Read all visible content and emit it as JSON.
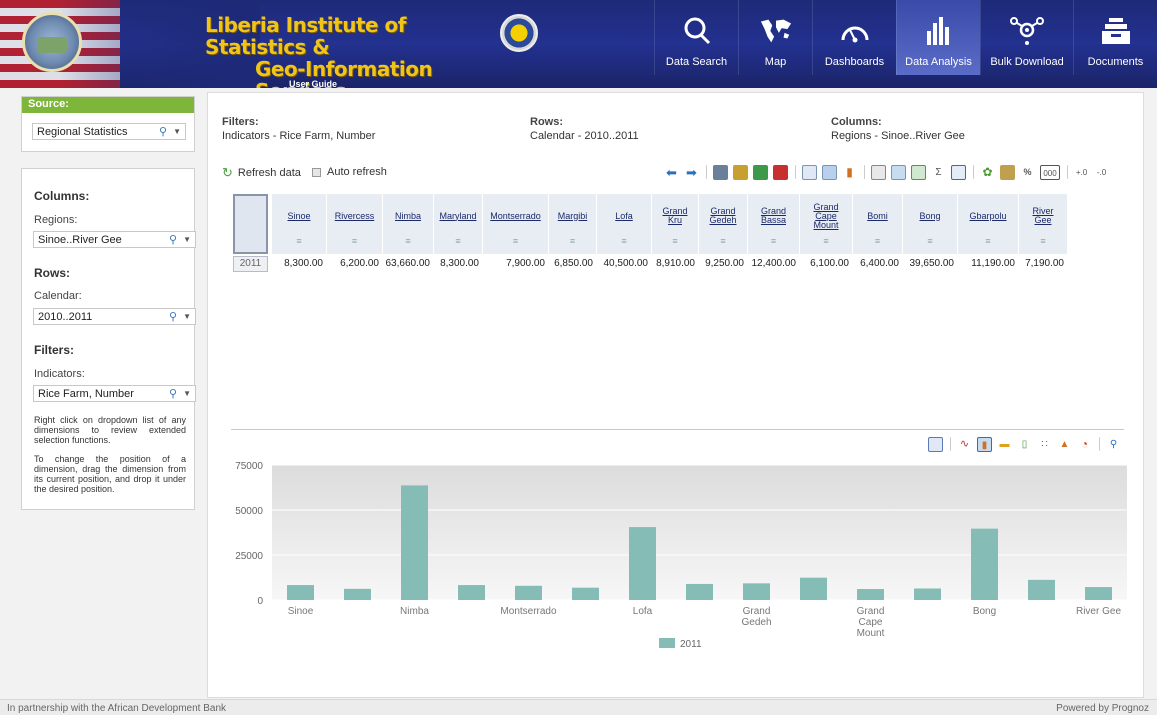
{
  "header": {
    "title_line1": "Liberia Institute of Statistics &",
    "title_line2": "Geo-Information Services",
    "user_guide": "User Guide",
    "nav": [
      {
        "label": "Data Search",
        "icon": "search-icon"
      },
      {
        "label": "Map",
        "icon": "world-map-icon"
      },
      {
        "label": "Dashboards",
        "icon": "gauge-icon"
      },
      {
        "label": "Data Analysis",
        "icon": "bar-chart-icon",
        "active": true
      },
      {
        "label": "Bulk Download",
        "icon": "network-icon"
      },
      {
        "label": "Documents",
        "icon": "document-stack-icon"
      }
    ]
  },
  "source": {
    "heading": "Source:",
    "value": "Regional Statistics"
  },
  "dimensions": {
    "columns_heading": "Columns:",
    "columns_label": "Regions:",
    "columns_value": "Sinoe..River Gee",
    "rows_heading": "Rows:",
    "rows_label": "Calendar:",
    "rows_value": "2010..2011",
    "filters_heading": "Filters:",
    "filters_label": "Indicators:",
    "filters_value": "Rice Farm, Number",
    "help1": "Right click on dropdown list of any dimensions to review extended selection functions.",
    "help2": "To change the position of a dimension, drag the dimension from its current position, and drop it under the desired position."
  },
  "summary": {
    "filters_h": "Filters:",
    "filters_v": "Indicators - Rice Farm, Number",
    "rows_h": "Rows:",
    "rows_v": "Calendar - 2010..2011",
    "columns_h": "Columns:",
    "columns_v": "Regions - Sinoe..River Gee"
  },
  "controls": {
    "refresh": "Refresh data",
    "auto_refresh": "Auto refresh",
    "sigma": "Σ",
    "percent": "%",
    "thousands": "000"
  },
  "table": {
    "columns": [
      "Sinoe",
      "Rivercess",
      "Nimba",
      "Maryland",
      "Montserrado",
      "Margibi",
      "Lofa",
      "Grand\nKru",
      "Grand\nGedeh",
      "Grand\nBassa",
      "Grand\nCape\nMount",
      "Bomi",
      "Bong",
      "Gbarpolu",
      "River\nGee"
    ],
    "row_label": "2011",
    "values": [
      "8,300.00",
      "6,200.00",
      "63,660.00",
      "8,300.00",
      "7,900.00",
      "6,850.00",
      "40,500.00",
      "8,910.00",
      "9,250.00",
      "12,400.00",
      "6,100.00",
      "6,400.00",
      "39,650.00",
      "11,190.00",
      "7,190.00"
    ]
  },
  "chart_data": {
    "type": "bar",
    "categories": [
      "Sinoe",
      "Rivercess",
      "Nimba",
      "Maryland",
      "Montserrado",
      "Margibi",
      "Lofa",
      "Grand Kru",
      "Grand Gedeh",
      "Grand Bassa",
      "Grand Cape Mount",
      "Bomi",
      "Bong",
      "Gbarpolu",
      "River Gee"
    ],
    "shown_labels": [
      "Sinoe",
      "",
      "Nimba",
      "",
      "Montserrado",
      "",
      "Lofa",
      "",
      "Grand\nGedeh",
      "",
      "Grand\nCape\nMount",
      "",
      "Bong",
      "",
      "River Gee"
    ],
    "series": [
      {
        "name": "2011",
        "values": [
          8300,
          6200,
          63660,
          8300,
          7900,
          6850,
          40500,
          8910,
          9250,
          12400,
          6100,
          6400,
          39650,
          11190,
          7190
        ]
      }
    ],
    "y_ticks": [
      "0",
      "25000",
      "50000",
      "75000"
    ],
    "ylim": [
      0,
      75000
    ],
    "grid": true,
    "legend": "bottom",
    "color": "#86bcb6"
  },
  "footer": {
    "left": "In partnership with the African Development Bank",
    "right": "Powered by Prognoz"
  }
}
